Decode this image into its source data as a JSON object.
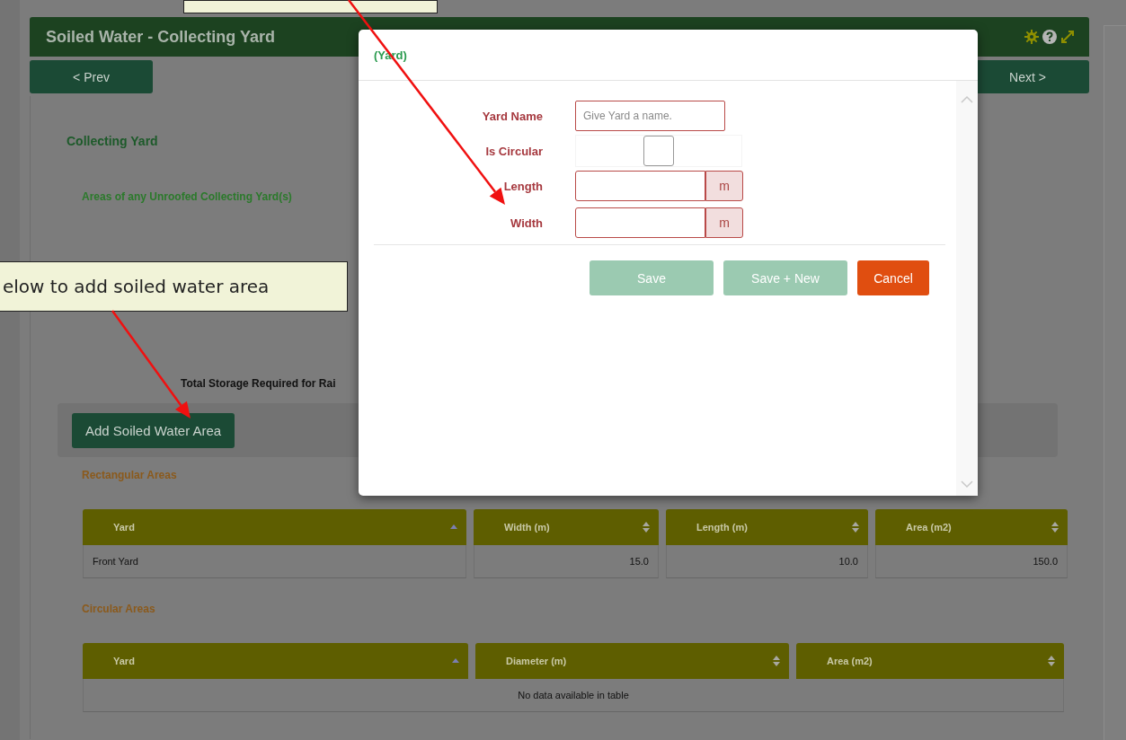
{
  "panel": {
    "title": "Soiled Water - Collecting Yard",
    "prev_button": "< Prev",
    "next_button": "Next >"
  },
  "section_title": "Collecting Yard",
  "subtitle": "Areas of any Unroofed Collecting Yard(s)",
  "total_storage_label": "Total Storage Required for Rai",
  "add_button": "Add Soiled Water Area",
  "rectangular": {
    "title": "Rectangular Areas",
    "columns": [
      {
        "label": "Yard",
        "sorted": true
      },
      {
        "label": "Width (m)",
        "sorted": false
      },
      {
        "label": "Length (m)",
        "sorted": false
      },
      {
        "label": "Area (m2)",
        "sorted": false
      }
    ],
    "rows": [
      [
        "Front Yard",
        "15.0",
        "10.0",
        "150.0"
      ]
    ]
  },
  "circular": {
    "title": "Circular Areas",
    "columns": [
      {
        "label": "Yard",
        "sorted": true
      },
      {
        "label": "Diameter (m)",
        "sorted": false
      },
      {
        "label": "Area (m2)",
        "sorted": false
      }
    ],
    "empty_message": "No data available in table"
  },
  "modal": {
    "title": "(Yard)",
    "fields": [
      {
        "kind": "text",
        "label": "Yard Name",
        "placeholder": "Give Yard a name."
      },
      {
        "kind": "checkbox",
        "label": "Is Circular",
        "checked": false
      },
      {
        "kind": "unit",
        "label": "Length",
        "unit": "m"
      },
      {
        "kind": "unit",
        "label": "Width",
        "unit": "m"
      }
    ],
    "buttons": [
      {
        "kind": "save",
        "label": "Save",
        "disabled": true
      },
      {
        "kind": "save",
        "label": "Save + New",
        "disabled": true
      },
      {
        "kind": "cancel",
        "label": "Cancel",
        "disabled": false
      }
    ]
  },
  "callout": {
    "text": "elow to add soiled water area"
  }
}
